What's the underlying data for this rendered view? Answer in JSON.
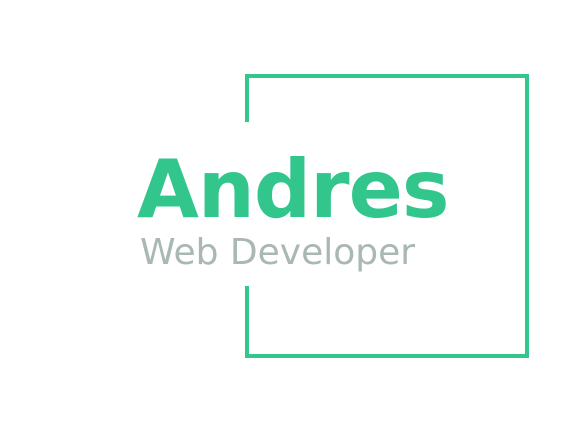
{
  "logo": {
    "name": "Andres",
    "tagline": "Web Developer",
    "colors": {
      "accent": "#32c68c",
      "tagline": "#a9b8b1",
      "background": "#ffffff"
    },
    "decoration": "open-square-frame"
  }
}
